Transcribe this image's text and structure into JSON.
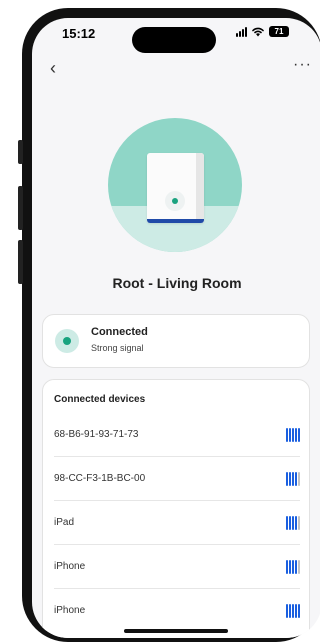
{
  "status_bar": {
    "time": "15:12",
    "battery": "71"
  },
  "nav": {
    "back_glyph": "‹",
    "more_glyph": "···"
  },
  "device": {
    "name": "Root - Living Room"
  },
  "status": {
    "title": "Connected",
    "subtitle": "Strong signal"
  },
  "connected_devices": {
    "header": "Connected devices",
    "items": [
      {
        "name": "68-B6-91-93-71-73",
        "signal_bars": 5
      },
      {
        "name": "98-CC-F3-1B-BC-00",
        "signal_bars": 4
      },
      {
        "name": "iPad",
        "signal_bars": 4
      },
      {
        "name": "iPhone",
        "signal_bars": 4
      },
      {
        "name": "iPhone",
        "signal_bars": 5
      }
    ]
  },
  "colors": {
    "accent_teal": "#8fd6c7",
    "status_green": "#18a37f",
    "signal_blue": "#1a5fe0"
  }
}
